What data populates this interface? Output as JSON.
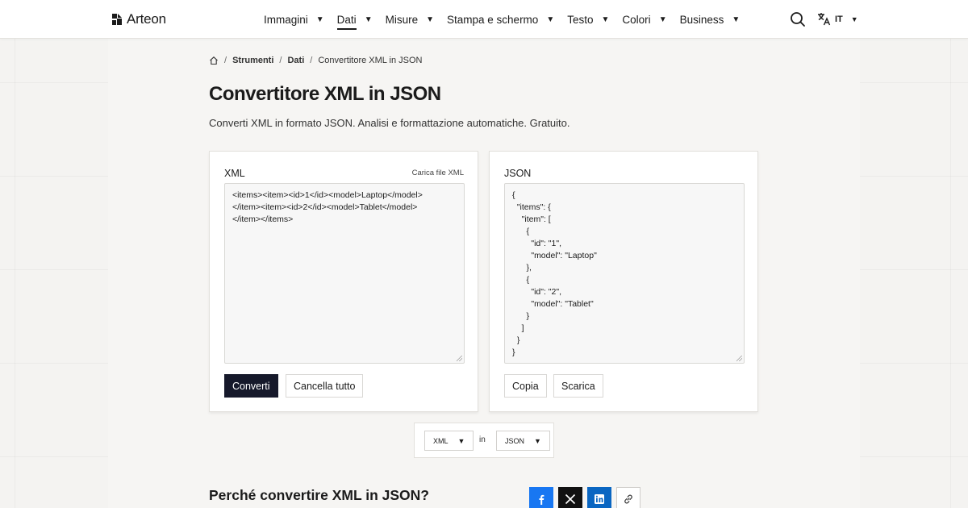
{
  "header": {
    "brand": "Arteon",
    "nav": [
      {
        "label": "Immagini",
        "active": false
      },
      {
        "label": "Dati",
        "active": true
      },
      {
        "label": "Misure",
        "active": false
      },
      {
        "label": "Stampa e schermo",
        "active": false
      },
      {
        "label": "Testo",
        "active": false
      },
      {
        "label": "Colori",
        "active": false
      },
      {
        "label": "Business",
        "active": false
      }
    ],
    "language": "IT",
    "icons": {
      "search": "search-icon",
      "language": "translate-icon",
      "home": "home-icon"
    }
  },
  "breadcrumb": {
    "items": [
      "Strumenti",
      "Dati",
      "Convertitore XML in JSON"
    ]
  },
  "page": {
    "title": "Convertitore XML in JSON",
    "subtitle": "Converti XML in formato JSON. Analisi e formattazione automatiche. Gratuito."
  },
  "input_card": {
    "label": "XML",
    "upload_label": "Carica file XML",
    "value": "<items><item><id>1</id><model>Laptop</model>\n</item><item><id>2</id><model>Tablet</model>\n</item></items>",
    "convert_label": "Converti",
    "clear_label": "Cancella tutto"
  },
  "output_card": {
    "label": "JSON",
    "value": "{\n  \"items\": {\n    \"item\": [\n      {\n        \"id\": \"1\",\n        \"model\": \"Laptop\"\n      },\n      {\n        \"id\": \"2\",\n        \"model\": \"Tablet\"\n      }\n    ]\n  }\n}",
    "copy_label": "Copia",
    "download_label": "Scarica"
  },
  "converter": {
    "from": "XML",
    "connector": "in",
    "to": "JSON"
  },
  "section": {
    "title": "Perché convertire XML in JSON?"
  },
  "share": {
    "colors": {
      "facebook": "#1877f2",
      "x": "#111111",
      "linkedin": "#0a66c2"
    }
  }
}
